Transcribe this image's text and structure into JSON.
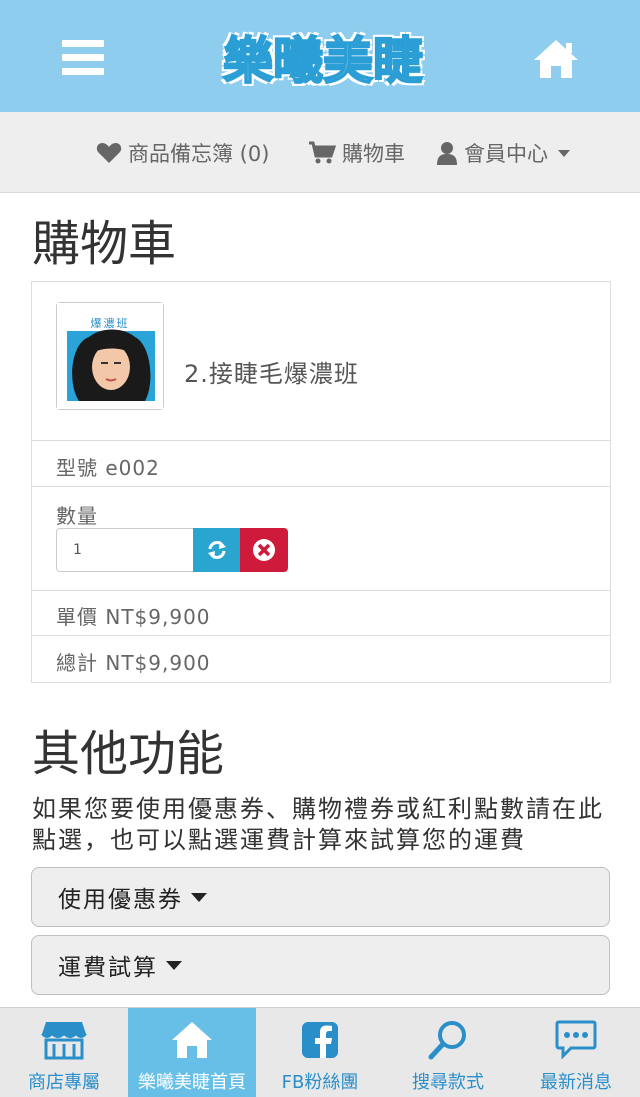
{
  "header": {
    "logo_text": "樂曦美睫",
    "menu_icon": "hamburger-menu-icon",
    "home_icon": "home-icon"
  },
  "topnav": {
    "wishlist": "商品備忘簿 (0)",
    "cart": "購物車",
    "member": "會員中心"
  },
  "cart": {
    "title": "購物車",
    "thumbnail_caption": "爆濃班",
    "product_name": "2.接睫毛爆濃班",
    "model": "型號 e002",
    "quantity_label": "數量",
    "quantity_value": "1",
    "unit_price": "單價 NT$9,900",
    "total": "總計 NT$9,900"
  },
  "other": {
    "title": "其他功能",
    "description": "如果您要使用優惠券、購物禮券或紅利點數請在此點選，也可以點選運費計算來試算您的運費",
    "coupon_button": "使用優惠券",
    "shipping_button": "運費試算"
  },
  "bottom_tabs": [
    {
      "label": "商店專屬",
      "icon": "storefront-icon"
    },
    {
      "label": "樂曦美睫首頁",
      "icon": "home-icon"
    },
    {
      "label": "FB粉絲團",
      "icon": "facebook-icon"
    },
    {
      "label": "搜尋款式",
      "icon": "search-icon"
    },
    {
      "label": "最新消息",
      "icon": "chat-bubble-icon"
    }
  ],
  "colors": {
    "header_bg": "#8ecdee",
    "accent_blue": "#2aa5cf",
    "danger_red": "#cf1b3b",
    "tab_active": "#67bfe8"
  }
}
